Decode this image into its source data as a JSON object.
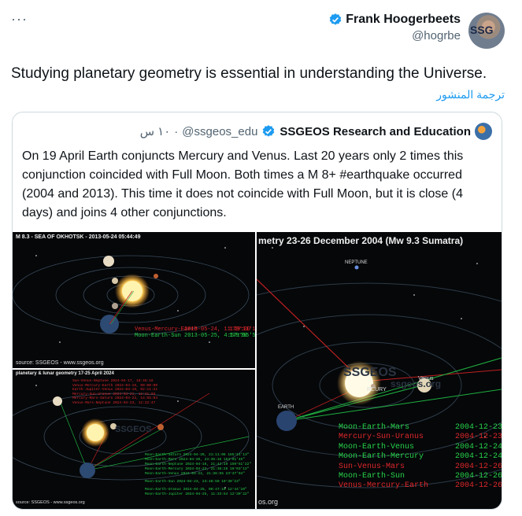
{
  "tweet": {
    "more_icon_text": "···",
    "author_name": "Frank Hoogerbeets",
    "author_handle": "@hogrbe",
    "avatar_text": "SSG",
    "text": "Studying planetary geometry is essential in understanding the Universe.",
    "translate_label": "ترجمة المنشور"
  },
  "quote": {
    "name": "SSGEOS Research and Education",
    "handle": "@ssgeos_edu",
    "time": "١٠ س",
    "separator": "·",
    "text": "On 19 April Earth conjuncts Mercury and Venus. Last 20 years only 2 times this conjunction coincided with Full Moon. Both times a M 8+ #earthquake occurred (2004 and 2013). This time it does not coincide with Full Moon, but it is close (4 days) and joins 4 other conjunctions."
  },
  "media": {
    "img1": {
      "title": "M 8.3 - SEA OF OKHOTSK - 2013-05-24 05:44:49",
      "source": "source: SSGEOS - www.ssgeos.org",
      "lines": [
        {
          "label": "Venus-Mercury-Earth",
          "date": "2013-05-24, 11:19:00",
          "value": "179°11'12\""
        },
        {
          "label": "Moon-Earth-Sun",
          "date": "2013-05-25, 4:57:30",
          "value": "179°55'59\""
        }
      ]
    },
    "img2": {
      "title": "metry 23-26 December 2004 (Mw 9.3 Sumatra)",
      "source": "os.org",
      "labels": {
        "neptune": "NEPTUNE",
        "mercury": "RCURY",
        "venus": "Venus",
        "earth": "EARTH",
        "watermark": "SSGEOS",
        "watermark2": "ssgeos.org"
      },
      "lines": [
        {
          "label": "Moon-Earth-Mars",
          "date": "2004-12-23",
          "color": "#27d34a"
        },
        {
          "label": "Mercury-Sun-Uranus",
          "date": "2004-12-23",
          "color": "#e0272b"
        },
        {
          "label": "Moon-Earth-Venus",
          "date": "2004-12-24",
          "color": "#27d34a"
        },
        {
          "label": "Moon-Earth-Mercury",
          "date": "2004-12-24",
          "color": "#27d34a"
        },
        {
          "label": "Sun-Venus-Mars",
          "date": "2004-12-26",
          "color": "#e0272b"
        },
        {
          "label": "Moon-Earth-Sun",
          "date": "2004-12-26",
          "color": "#27d34a"
        },
        {
          "label": "Venus-Mercury-Earth",
          "date": "2004-12-26",
          "color": "#e0272b"
        }
      ]
    },
    "img3": {
      "title": "planetary & lunar geometry 17-25 April 2024",
      "source": "source: SSGEOS - www.ssgeos.org",
      "watermark": "SSGEOS",
      "top_lines": [
        {
          "label": "Sun-Venus-Neptune",
          "date": "2024-04-17, 18:48:16"
        },
        {
          "label": "Venus-Mercury-Earth",
          "date": "2024-04-19, 00:00:00"
        },
        {
          "label": "Earth-Jupiter-Venus",
          "date": "2024-04-19, 02:11:21"
        },
        {
          "label": "Mercury-Sun-Uranus",
          "date": "2024-04-21, 12:21:03"
        },
        {
          "label": "Mercury-Mars-Saturn",
          "date": "2024-04-22, 14:55:04"
        },
        {
          "label": "Venus-Mars-Neptune",
          "date": "2024-04-23, 12:22:47"
        }
      ],
      "bottom_lines": [
        {
          "label": "Moon-Earth-Saturn",
          "date": "2024-04-20, 21:11:06",
          "value": "165°14'13\""
        },
        {
          "label": "Moon-Earth-Mars",
          "date": "2024-04-20, 23:35:16",
          "value": "153°01'45\""
        },
        {
          "label": "Moon-Earth-Neptune",
          "date": "2024-04-16, 21:42:19",
          "value": "159°51'22\""
        },
        {
          "label": "Moon-Earth-Mercury",
          "date": "2024-04-22, 21:38:26",
          "value": "16°03'13\""
        },
        {
          "label": "Moon-Earth-Venus",
          "date": "2024-04-22, 21:38:55",
          "value": "23°37'04\""
        },
        {
          "label": "Moon-Earth-Sun",
          "date": "2024-04-23, 23:48:50",
          "value": "10°30'23\""
        },
        {
          "label": "Moon-Earth-Uranus",
          "date": "2024-04-25, 09:47:19",
          "value": "12°44'10\""
        },
        {
          "label": "Moon-Earth-Jupiter",
          "date": "2024-04-25, 11:33:54",
          "value": "12°30'22\""
        }
      ]
    }
  },
  "colors": {
    "link": "#1d9bf0",
    "verified": "#1d9bf0",
    "muted": "#536471",
    "border": "#cfd9de",
    "green": "#27d34a",
    "red": "#e0272b"
  }
}
